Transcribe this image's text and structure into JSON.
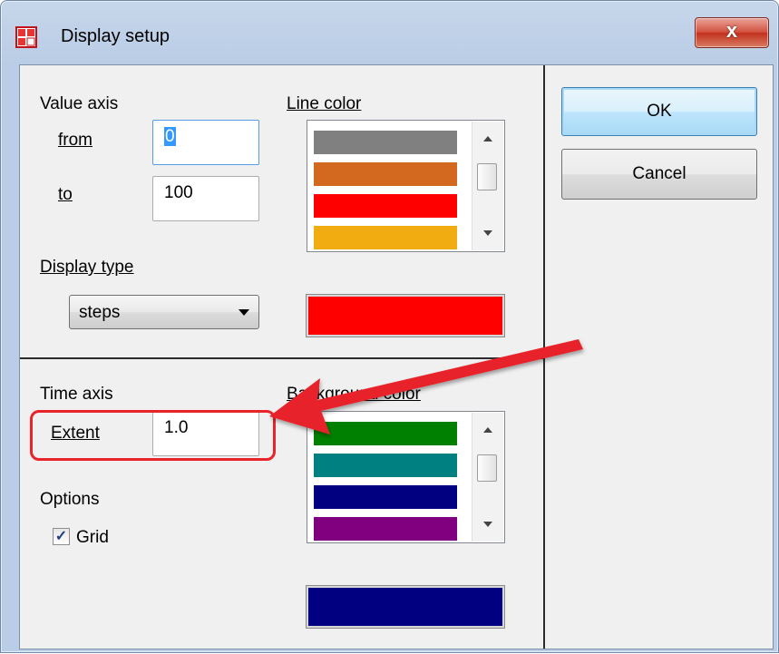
{
  "window": {
    "title": "Display setup",
    "close_label": "x"
  },
  "value_axis": {
    "heading": "Value axis",
    "from_label": "from",
    "from_value": "0",
    "to_label": "to",
    "to_value": "100"
  },
  "line_color": {
    "heading": "Line color",
    "items": [
      {
        "color": "#808080"
      },
      {
        "color": "#d2691e"
      },
      {
        "color": "#ff0000"
      },
      {
        "color": "#f0ac10"
      }
    ],
    "selected": "#ff0000"
  },
  "display_type": {
    "heading": "Display type",
    "selected": "steps"
  },
  "time_axis": {
    "heading": "Time axis",
    "extent_label": "Extent",
    "extent_value": "1.0"
  },
  "background_color": {
    "heading": "Background color",
    "items": [
      {
        "color": "#008000"
      },
      {
        "color": "#008080"
      },
      {
        "color": "#000080"
      },
      {
        "color": "#800080"
      }
    ],
    "selected": "#000080"
  },
  "options": {
    "heading": "Options",
    "grid_label": "Grid",
    "grid_checked": true
  },
  "buttons": {
    "ok": "OK",
    "cancel": "Cancel"
  },
  "annotation": {
    "color": "#e8242a"
  }
}
